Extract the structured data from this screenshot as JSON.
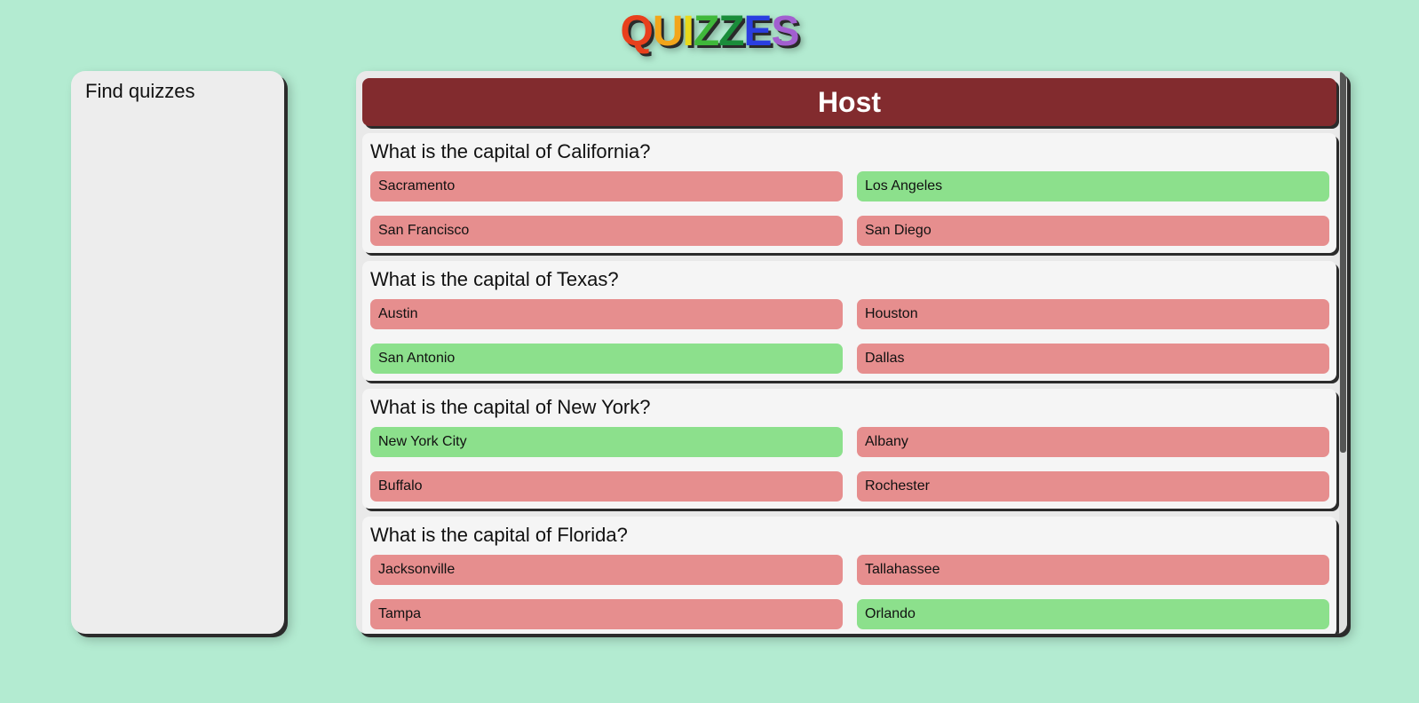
{
  "logo": {
    "letters": [
      {
        "char": "Q",
        "color": "#e8401c"
      },
      {
        "char": "U",
        "color": "#f2a51a"
      },
      {
        "char": "I",
        "color": "#e8d81a"
      },
      {
        "char": "Z",
        "color": "#3fb83a"
      },
      {
        "char": "Z",
        "color": "#1a8c3a"
      },
      {
        "char": "E",
        "color": "#2a3ee0"
      },
      {
        "char": "S",
        "color": "#a25fd0"
      }
    ]
  },
  "sidebar": {
    "title": "Find quizzes"
  },
  "host": {
    "title": "Host",
    "colors": {
      "header": "#822b2e",
      "correct": "#8ce08c",
      "incorrect": "#e68e8e"
    },
    "questions": [
      {
        "text": "What is the capital of California?",
        "answers": [
          {
            "label": "Sacramento",
            "highlighted": false
          },
          {
            "label": "Los Angeles",
            "highlighted": true
          },
          {
            "label": "San Francisco",
            "highlighted": false
          },
          {
            "label": "San Diego",
            "highlighted": false
          }
        ]
      },
      {
        "text": "What is the capital of Texas?",
        "answers": [
          {
            "label": "Austin",
            "highlighted": false
          },
          {
            "label": "Houston",
            "highlighted": false
          },
          {
            "label": "San Antonio",
            "highlighted": true
          },
          {
            "label": "Dallas",
            "highlighted": false
          }
        ]
      },
      {
        "text": "What is the capital of New York?",
        "answers": [
          {
            "label": "New York City",
            "highlighted": true
          },
          {
            "label": "Albany",
            "highlighted": false
          },
          {
            "label": "Buffalo",
            "highlighted": false
          },
          {
            "label": "Rochester",
            "highlighted": false
          }
        ]
      },
      {
        "text": "What is the capital of Florida?",
        "answers": [
          {
            "label": "Jacksonville",
            "highlighted": false
          },
          {
            "label": "Tallahassee",
            "highlighted": false
          },
          {
            "label": "Tampa",
            "highlighted": false
          },
          {
            "label": "Orlando",
            "highlighted": true
          }
        ]
      }
    ]
  }
}
